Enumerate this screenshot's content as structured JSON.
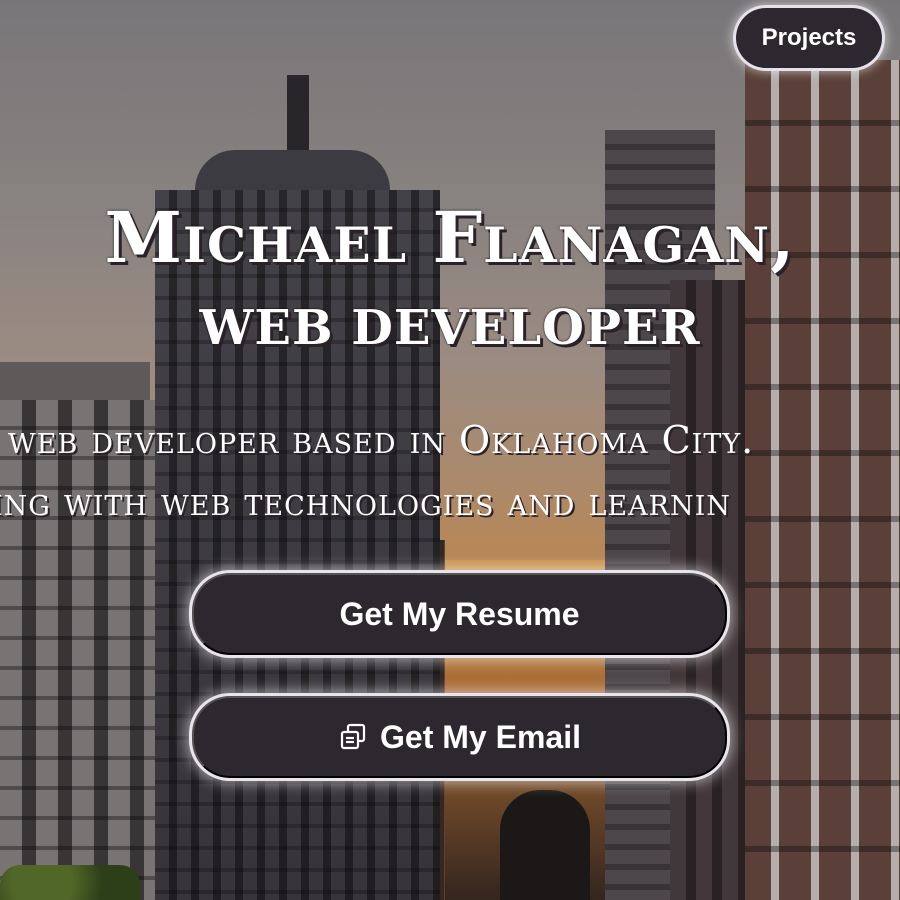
{
  "nav": {
    "projects_label": "Projects"
  },
  "hero": {
    "name": "Michael Flanagan,",
    "role": "web developer",
    "tagline_line1": "web developer based in Oklahoma City.",
    "tagline_line2": "ing with web technologies and learnin"
  },
  "actions": {
    "resume_label": "Get My Resume",
    "email_label": "Get My Email",
    "email_icon": "copy-icon"
  },
  "colors": {
    "button_bg": "#2d2830",
    "button_border": "#e6e1ea",
    "text": "#ffffff"
  }
}
